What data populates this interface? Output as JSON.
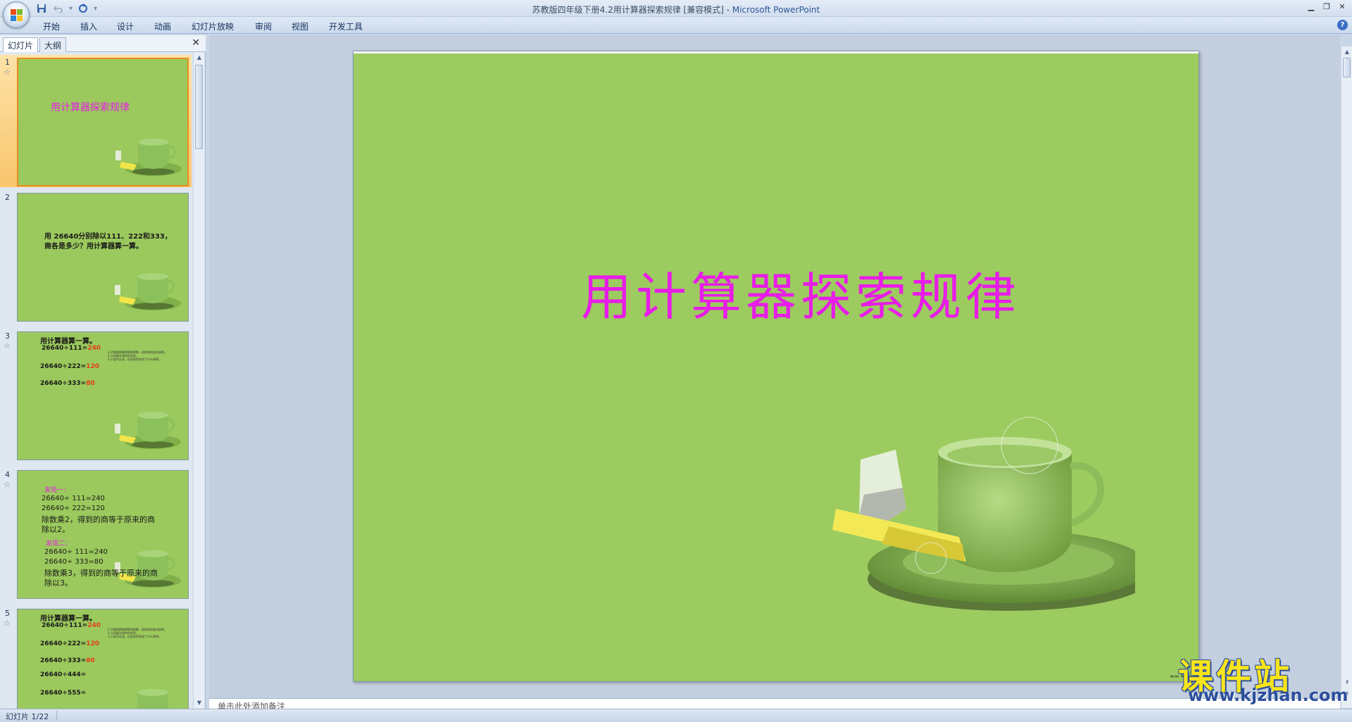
{
  "window": {
    "title_doc": "苏教版四年级下册4.2用计算器探索规律 [兼容模式]",
    "title_sep": " - ",
    "title_app": "Microsoft PowerPoint"
  },
  "quick_access": {
    "icons": [
      "save-icon",
      "undo-icon",
      "redo-icon",
      "customize-icon"
    ]
  },
  "ribbon": {
    "tabs": [
      "开始",
      "插入",
      "设计",
      "动画",
      "幻灯片放映",
      "审阅",
      "视图",
      "开发工具"
    ]
  },
  "left_panel": {
    "tab_slides": "幻灯片",
    "tab_outline": "大纲",
    "close": "✕"
  },
  "thumbnails": [
    {
      "num": "1",
      "title": "用计算器探索规律"
    },
    {
      "num": "2",
      "line1": "用 26640分别除以111、222和333，",
      "line2": "商各是多少？用计算器算一算。"
    },
    {
      "num": "3",
      "head": "用计算器算一算。",
      "rows": [
        {
          "expr": "26640÷111=",
          "ans": "240"
        },
        {
          "expr": "26640÷222=",
          "ans": "120"
        },
        {
          "expr": "26640÷333=",
          "ans": "80"
        }
      ],
      "notes": [
        "1.仔细观察被除数和除数，说说商的变化规律。",
        "2.与同桌交流你的发现。",
        "3.小组内交流，在说说你发现了什么规律。"
      ]
    },
    {
      "num": "4",
      "lbl1": "发现一：",
      "a1": "26640÷ 111=240",
      "a2": "26640÷ 222=120",
      "a3": "除数乘2，得到的商等于原来的商",
      "a4": "除以2。",
      "lbl2": "发现二：",
      "b1": "26640÷ 111=240",
      "b2": "26640÷ 333=80",
      "b3": "除数乘3，得到的商等于原来的商",
      "b4": "除以3。"
    },
    {
      "num": "5",
      "head": "用计算器算一算。",
      "rows": [
        {
          "expr": "26640÷111=",
          "ans": "240"
        },
        {
          "expr": "26640÷222=",
          "ans": "120"
        },
        {
          "expr": "26640÷333=",
          "ans": "80"
        },
        {
          "expr": "26640÷444=",
          "ans": ""
        },
        {
          "expr": "26640÷555=",
          "ans": ""
        }
      ],
      "notes": [
        "1.仔细观察被除数和除数，说说商的变化规律。",
        "2.与同桌交流你的发现。",
        "3.小组内交流，在说说你发现了什么规律。"
      ]
    }
  ],
  "slide": {
    "title": "用计算器探索规律",
    "title_color": "#e81ce8",
    "bg_color": "#9ccb5f"
  },
  "notes": {
    "placeholder": "单击此处添加备注"
  },
  "status": {
    "slide_info": "幻灯片 1/22"
  },
  "watermark": {
    "big": "课件站",
    "small": "www.kjzhan.com"
  }
}
